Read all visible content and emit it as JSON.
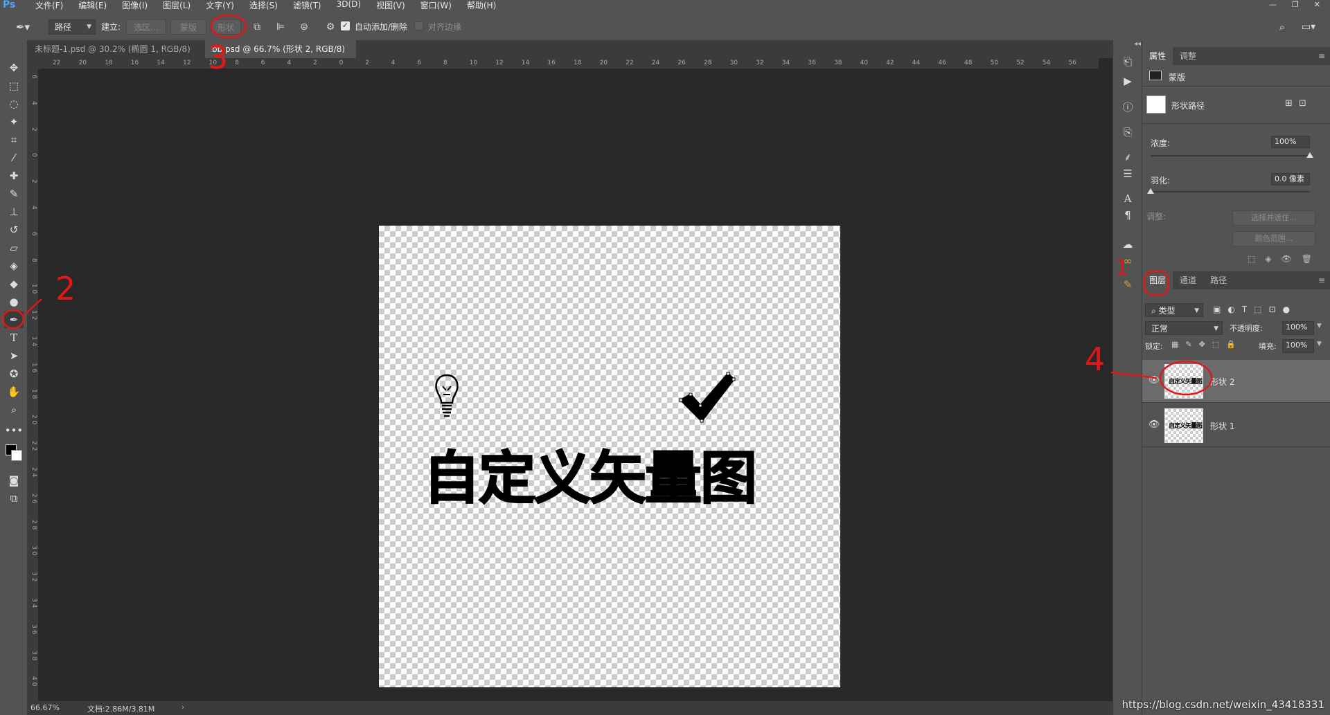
{
  "app": {
    "logo": "Ps"
  },
  "menu": [
    "文件(F)",
    "编辑(E)",
    "图像(I)",
    "图层(L)",
    "文字(Y)",
    "选择(S)",
    "滤镜(T)",
    "3D(D)",
    "视图(V)",
    "窗口(W)",
    "帮助(H)"
  ],
  "options": {
    "mode_value": "路径",
    "build_label": "建立:",
    "selection_btn": "选区...",
    "mask_btn": "蒙版",
    "shape_btn": "形状",
    "auto_add_label": "自动添加/删除",
    "auto_add_checked": true,
    "align_edges_label": "对齐边缘"
  },
  "tabs": [
    {
      "label": "未标题-1.psd @ 30.2% (椭圆 1, RGB/8) *",
      "active": false
    },
    {
      "label": "bb.psd @ 66.7% (形状 2, RGB/8) *",
      "active": true
    }
  ],
  "rulers": {
    "top": [
      "22",
      "20",
      "18",
      "16",
      "14",
      "12",
      "10",
      "8",
      "6",
      "4",
      "2",
      "0",
      "2",
      "4",
      "6",
      "8",
      "10",
      "12",
      "14",
      "16",
      "18",
      "20",
      "22",
      "24",
      "26",
      "28",
      "30",
      "32",
      "34",
      "36",
      "38",
      "40",
      "42",
      "44",
      "46",
      "48",
      "50",
      "52",
      "54",
      "56"
    ],
    "left": [
      "6",
      "4",
      "2",
      "0",
      "2",
      "4",
      "6",
      "8",
      "1 0",
      "1 2",
      "1 4",
      "1 6",
      "1 8",
      "2 0",
      "2 2",
      "2 4",
      "2 6",
      "2 8",
      "3 0",
      "3 2",
      "3 4",
      "3 6",
      "3 8",
      "4 0"
    ]
  },
  "canvas": {
    "artwork_text": "自定义矢量图"
  },
  "status": {
    "zoom": "66.67%",
    "doc_info": "文档:2.86M/3.81M"
  },
  "properties": {
    "tabs": [
      "属性",
      "调整"
    ],
    "mask_type": "蒙版",
    "shape_path_label": "形状路径",
    "density_label": "浓度:",
    "density_value": "100%",
    "feather_label": "羽化:",
    "feather_value": "0.0 像素",
    "adjust_label": "调整:",
    "select_mask_btn": "选择并遮住...",
    "color_range_btn": "颜色范围...",
    "density_level": 1.0,
    "feather_level": 0.0
  },
  "layers": {
    "tabs": [
      "图层",
      "通道",
      "路径"
    ],
    "filter_kind": "类型",
    "blend_mode": "正常",
    "opacity_label": "不透明度:",
    "opacity_value": "100%",
    "lock_label": "锁定:",
    "fill_label": "填充:",
    "fill_value": "100%",
    "items": [
      {
        "name": "形状 2",
        "thumb_text": "自定义矢量图",
        "selected": true
      },
      {
        "name": "形状 1",
        "thumb_text": "自定义矢量图",
        "selected": false
      }
    ]
  },
  "annotations": [
    "1",
    "2",
    "3",
    "4"
  ],
  "watermark": "https://blog.csdn.net/weixin_43418331"
}
